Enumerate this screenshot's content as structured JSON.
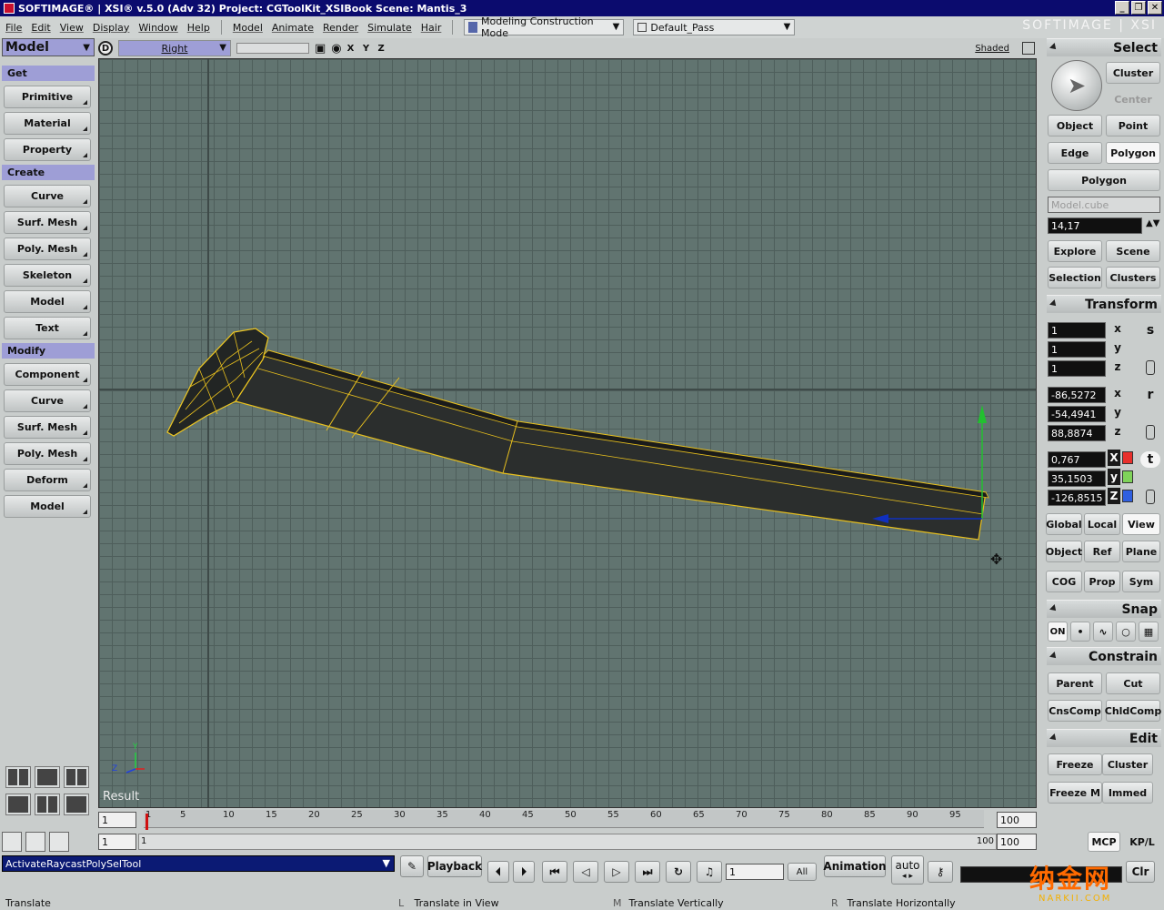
{
  "title": "SOFTIMAGE® | XSI® v.5.0 (Adv 32) Project: CGToolKit_XSIBook     Scene: Mantis_3",
  "brand": "SOFTIMAGE | XSI",
  "window_buttons": [
    "_",
    "❐",
    "✕"
  ],
  "menu": {
    "left": [
      "File",
      "Edit",
      "View",
      "Display",
      "Window",
      "Help"
    ],
    "modules": [
      "Model",
      "Animate",
      "Render",
      "Simulate",
      "Hair"
    ],
    "construction_mode": "Modeling Construction Mode",
    "pass": "Default_Pass"
  },
  "left": {
    "module": "Model",
    "get_header": "Get",
    "get_items": [
      "Primitive",
      "Material",
      "Property"
    ],
    "create_header": "Create",
    "create_items": [
      "Curve",
      "Surf. Mesh",
      "Poly. Mesh",
      "Skeleton",
      "Model",
      "Text"
    ],
    "modify_header": "Modify",
    "modify_items": [
      "Component",
      "Curve",
      "Surf. Mesh",
      "Poly. Mesh",
      "Deform",
      "Model"
    ]
  },
  "viewport": {
    "view_label": "D",
    "camera": "Right",
    "axes_label": "X Y Z",
    "shading": "Shaded",
    "result": "Result"
  },
  "timeline": {
    "start": "1",
    "end": "100",
    "current": "1",
    "range_start": "1",
    "range_end": "100",
    "range_end2": "100",
    "ticks": [
      "1",
      "5",
      "10",
      "15",
      "20",
      "25",
      "30",
      "35",
      "40",
      "45",
      "50",
      "55",
      "60",
      "65",
      "70",
      "75",
      "80",
      "85",
      "90",
      "95"
    ]
  },
  "right": {
    "select_header": "Select",
    "cluster": "Cluster",
    "center": "Center",
    "object": "Object",
    "point": "Point",
    "edge": "Edge",
    "polygon": "Polygon",
    "polygon_combo": "Polygon",
    "selection_name": "Model.cube",
    "selection_count": "14,17",
    "explore": "Explore",
    "scene": "Scene",
    "selection": "Selection",
    "clusters": "Clusters",
    "transform_header": "Transform",
    "scale": [
      "1",
      "1",
      "1"
    ],
    "rotate": [
      "-86,5272",
      "-54,4941",
      "88,8874"
    ],
    "translate": [
      "0,767",
      "35,1503",
      "-126,8515"
    ],
    "axis_labels": [
      "x",
      "y",
      "z"
    ],
    "translate_axis_labels": [
      "X",
      "y",
      "Z"
    ],
    "mode_letters": [
      "s",
      "r",
      "t"
    ],
    "global": "Global",
    "local": "Local",
    "view": "View",
    "object2": "Object",
    "ref": "Ref",
    "plane": "Plane",
    "cog": "COG",
    "prop": "Prop",
    "sym": "Sym",
    "snap_header": "Snap",
    "snap_on": "ON",
    "constrain_header": "Constrain",
    "parent": "Parent",
    "cut": "Cut",
    "cnscomp": "CnsComp",
    "chldcomp": "ChldComp",
    "edit_header": "Edit",
    "freeze": "Freeze",
    "cluster2": "Cluster",
    "freeze_m": "Freeze M",
    "immed": "Immed",
    "mcp": "MCP",
    "kpl": "KP/L",
    "colors": {
      "x": "#e8302c",
      "y": "#7fd35a",
      "z": "#2f5fe0"
    }
  },
  "status": {
    "command": "ActivateRaycastPolySelTool",
    "playback": "Playback",
    "frame": "1",
    "all": "All",
    "animation": "Animation",
    "auto": "auto",
    "clr": "Clr",
    "mode": "Translate",
    "hints": [
      {
        "key": "L",
        "text": "Translate in View"
      },
      {
        "key": "M",
        "text": "Translate Vertically"
      },
      {
        "key": "R",
        "text": "Translate Horizontally"
      }
    ]
  },
  "watermark": "纳金网",
  "watermark_url": "NARKII.COM"
}
